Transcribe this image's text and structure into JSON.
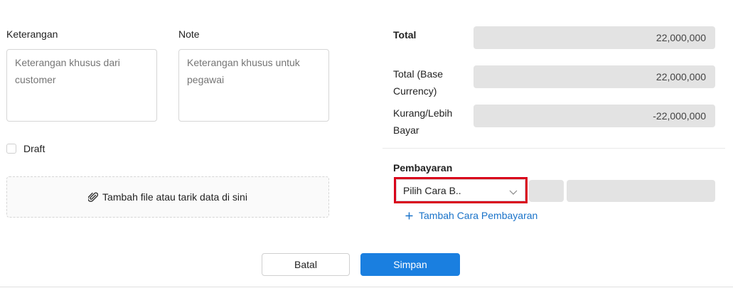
{
  "form": {
    "keterangan_label": "Keterangan",
    "keterangan_placeholder": "Keterangan khusus dari customer",
    "note_label": "Note",
    "note_placeholder": "Keterangan khusus untuk pegawai",
    "draft_label": "Draft",
    "draft_checked": false,
    "upload_label": "Tambah file atau tarik data di sini",
    "upload_icon": "paperclip-icon"
  },
  "summary": {
    "total_label": "Total",
    "total_value": "22,000,000",
    "base_currency_label_line1": "Total (Base",
    "base_currency_label_line2": "Currency)",
    "base_currency_value": "22,000,000",
    "balance_label_line1": "Kurang/Lebih",
    "balance_label_line2": "Bayar",
    "balance_value": "-22,000,000"
  },
  "payment": {
    "section_label": "Pembayaran",
    "method_select_value": "Pilih Cara B..",
    "add_method_label": "Tambah Cara Pembayaran",
    "add_method_icon": "plus-icon"
  },
  "actions": {
    "cancel_label": "Batal",
    "save_label": "Simpan"
  },
  "colors": {
    "primary": "#1a7fe0",
    "link": "#1a73c9",
    "highlight": "#d9001b",
    "readonly_bg": "#e3e3e3"
  }
}
